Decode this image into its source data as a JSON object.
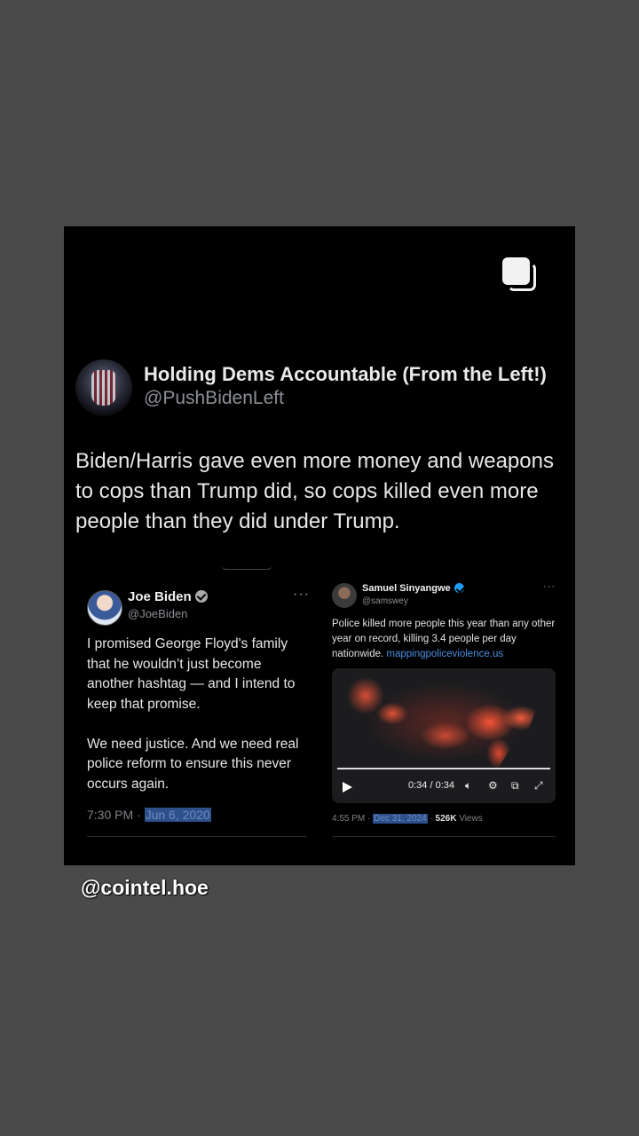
{
  "main_post": {
    "author_name": "Holding Dems Accountable (From the Left!)",
    "author_handle": "@PushBidenLeft",
    "text": "Biden/Harris gave even more money and weapons to cops than Trump did, so cops killed even more people than they did under Trump."
  },
  "left_tweet": {
    "name": "Joe Biden",
    "handle": "@JoeBiden",
    "more": "···",
    "text": "I promised George Floyd's family that he wouldn’t just become another hashtag — and I intend to keep that promise.\n\nWe need justice. And we need real police reform to ensure this never occurs again.",
    "time": "7:30 PM ·",
    "date": "Jun 6, 2020"
  },
  "right_tweet": {
    "name": "Samuel Sinyangwe",
    "handle": "@samswey",
    "more": "···",
    "text": "Police killed more people this year than any other year on record, killing 3.4 people per day nationwide.",
    "link": "mappingpoliceviolence.us",
    "video_time": "0:34 / 0:34",
    "progress": 1.0,
    "time": "4:55 PM ·",
    "date": "Dec 31, 2024",
    "views_count": "526K",
    "views_label": "Views"
  },
  "watermark": "@cointel.hoe"
}
